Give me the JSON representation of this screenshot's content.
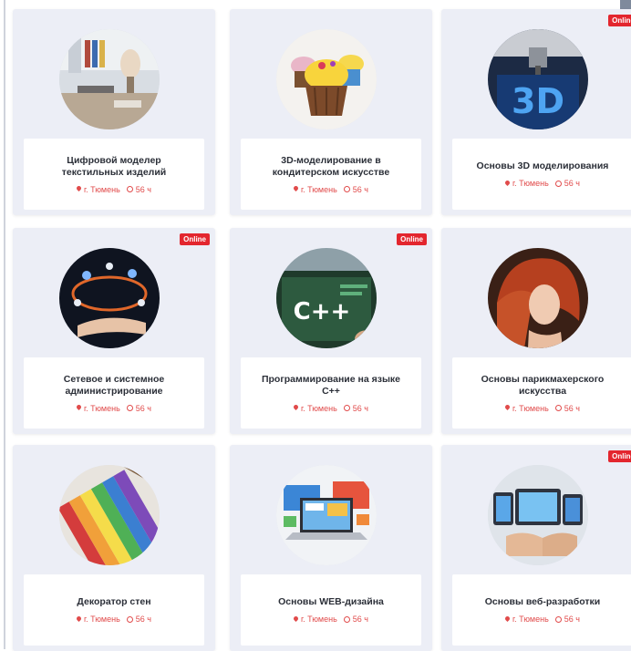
{
  "courses": [
    {
      "title": "Цифровой моделер текстильных изделий",
      "city": "г. Тюмень",
      "hours": "56 ч",
      "badge": "",
      "image": "fashion-studio"
    },
    {
      "title": "3D-моделирование в кондитерском искусстве",
      "city": "г. Тюмень",
      "hours": "56 ч",
      "badge": "",
      "image": "cupcakes"
    },
    {
      "title": "Основы 3D моделирования",
      "city": "г. Тюмень",
      "hours": "56 ч",
      "badge": "Online",
      "image": "3d-printer"
    },
    {
      "title": "Сетевое и системное администрирование",
      "city": "г. Тюмень",
      "hours": "56 ч",
      "badge": "Online",
      "image": "network-hand"
    },
    {
      "title": "Программирование на языке C++",
      "city": "г. Тюмень",
      "hours": "56 ч",
      "badge": "Online",
      "image": "cpp-screen"
    },
    {
      "title": "Основы парикмахерского искусства",
      "city": "г. Тюмень",
      "hours": "56 ч",
      "badge": "",
      "image": "red-hair"
    },
    {
      "title": "Декоратор стен",
      "city": "г. Тюмень",
      "hours": "56 ч",
      "badge": "",
      "image": "color-swatches"
    },
    {
      "title": "Основы WEB-дизайна",
      "city": "г. Тюмень",
      "hours": "56 ч",
      "badge": "",
      "image": "web-design-laptop"
    },
    {
      "title": "Основы веб-разработки",
      "city": "г. Тюмень",
      "hours": "56 ч",
      "badge": "Online",
      "image": "devices"
    }
  ],
  "colors": {
    "accent": "#e14b4b",
    "badge": "#e3262e",
    "card": "#eceef6",
    "title": "#2b2f38"
  },
  "icons": {
    "location": "map-pin-icon",
    "duration": "clock-icon"
  }
}
